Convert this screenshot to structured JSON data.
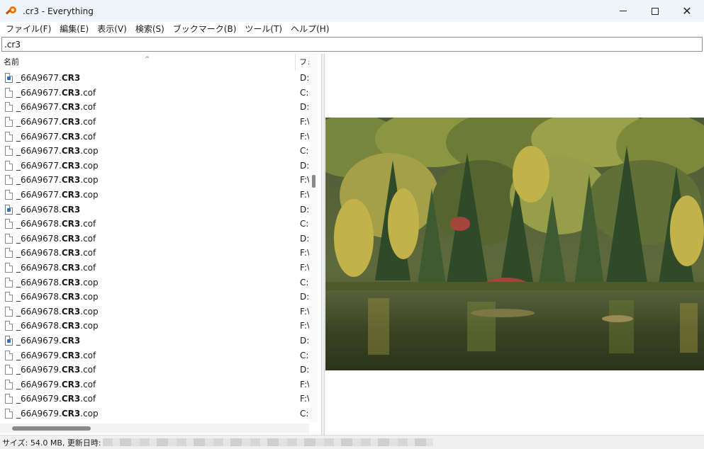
{
  "window": {
    "title": ".cr3 - Everything",
    "controls": {
      "minimize": "minimize",
      "maximize": "maximize",
      "close": "✕"
    }
  },
  "menu": [
    "ファイル(F)",
    "編集(E)",
    "表示(V)",
    "検索(S)",
    "ブックマーク(B)",
    "ツール(T)",
    "ヘルプ(H)"
  ],
  "search": {
    "value": ".cr3"
  },
  "columns": {
    "name": "名前",
    "folder": "フォ"
  },
  "results": [
    {
      "prefix": "_66A9677.",
      "match": "CR3",
      "suffix": "",
      "path": "D:",
      "icon": "raw-image-icon"
    },
    {
      "prefix": "_66A9677.",
      "match": "CR3",
      "suffix": ".cof",
      "path": "C:",
      "icon": "file-icon"
    },
    {
      "prefix": "_66A9677.",
      "match": "CR3",
      "suffix": ".cof",
      "path": "D:",
      "icon": "file-icon"
    },
    {
      "prefix": "_66A9677.",
      "match": "CR3",
      "suffix": ".cof",
      "path": "F:\\",
      "icon": "file-icon"
    },
    {
      "prefix": "_66A9677.",
      "match": "CR3",
      "suffix": ".cof",
      "path": "F:\\",
      "icon": "file-icon"
    },
    {
      "prefix": "_66A9677.",
      "match": "CR3",
      "suffix": ".cop",
      "path": "C:",
      "icon": "file-icon"
    },
    {
      "prefix": "_66A9677.",
      "match": "CR3",
      "suffix": ".cop",
      "path": "D:",
      "icon": "file-icon"
    },
    {
      "prefix": "_66A9677.",
      "match": "CR3",
      "suffix": ".cop",
      "path": "F:\\",
      "icon": "file-icon"
    },
    {
      "prefix": "_66A9677.",
      "match": "CR3",
      "suffix": ".cop",
      "path": "F:\\",
      "icon": "file-icon"
    },
    {
      "prefix": "_66A9678.",
      "match": "CR3",
      "suffix": "",
      "path": "D:",
      "icon": "raw-image-icon"
    },
    {
      "prefix": "_66A9678.",
      "match": "CR3",
      "suffix": ".cof",
      "path": "C:",
      "icon": "file-icon"
    },
    {
      "prefix": "_66A9678.",
      "match": "CR3",
      "suffix": ".cof",
      "path": "D:",
      "icon": "file-icon"
    },
    {
      "prefix": "_66A9678.",
      "match": "CR3",
      "suffix": ".cof",
      "path": "F:\\",
      "icon": "file-icon"
    },
    {
      "prefix": "_66A9678.",
      "match": "CR3",
      "suffix": ".cof",
      "path": "F:\\",
      "icon": "file-icon"
    },
    {
      "prefix": "_66A9678.",
      "match": "CR3",
      "suffix": ".cop",
      "path": "C:",
      "icon": "file-icon"
    },
    {
      "prefix": "_66A9678.",
      "match": "CR3",
      "suffix": ".cop",
      "path": "D:",
      "icon": "file-icon"
    },
    {
      "prefix": "_66A9678.",
      "match": "CR3",
      "suffix": ".cop",
      "path": "F:\\",
      "icon": "file-icon"
    },
    {
      "prefix": "_66A9678.",
      "match": "CR3",
      "suffix": ".cop",
      "path": "F:\\",
      "icon": "file-icon"
    },
    {
      "prefix": "_66A9679.",
      "match": "CR3",
      "suffix": "",
      "path": "D:",
      "icon": "raw-image-icon"
    },
    {
      "prefix": "_66A9679.",
      "match": "CR3",
      "suffix": ".cof",
      "path": "C:",
      "icon": "file-icon"
    },
    {
      "prefix": "_66A9679.",
      "match": "CR3",
      "suffix": ".cof",
      "path": "D:",
      "icon": "file-icon"
    },
    {
      "prefix": "_66A9679.",
      "match": "CR3",
      "suffix": ".cof",
      "path": "F:\\",
      "icon": "file-icon"
    },
    {
      "prefix": "_66A9679.",
      "match": "CR3",
      "suffix": ".cof",
      "path": "F:\\",
      "icon": "file-icon"
    },
    {
      "prefix": "_66A9679.",
      "match": "CR3",
      "suffix": ".cop",
      "path": "C:",
      "icon": "file-icon"
    }
  ],
  "status": {
    "text": "サイズ: 54.0 MB, 更新日時:"
  },
  "colors": {
    "titlebar": "#eff4f9",
    "accent": "#e8770a",
    "raw_icon": "#2f6fcb"
  }
}
